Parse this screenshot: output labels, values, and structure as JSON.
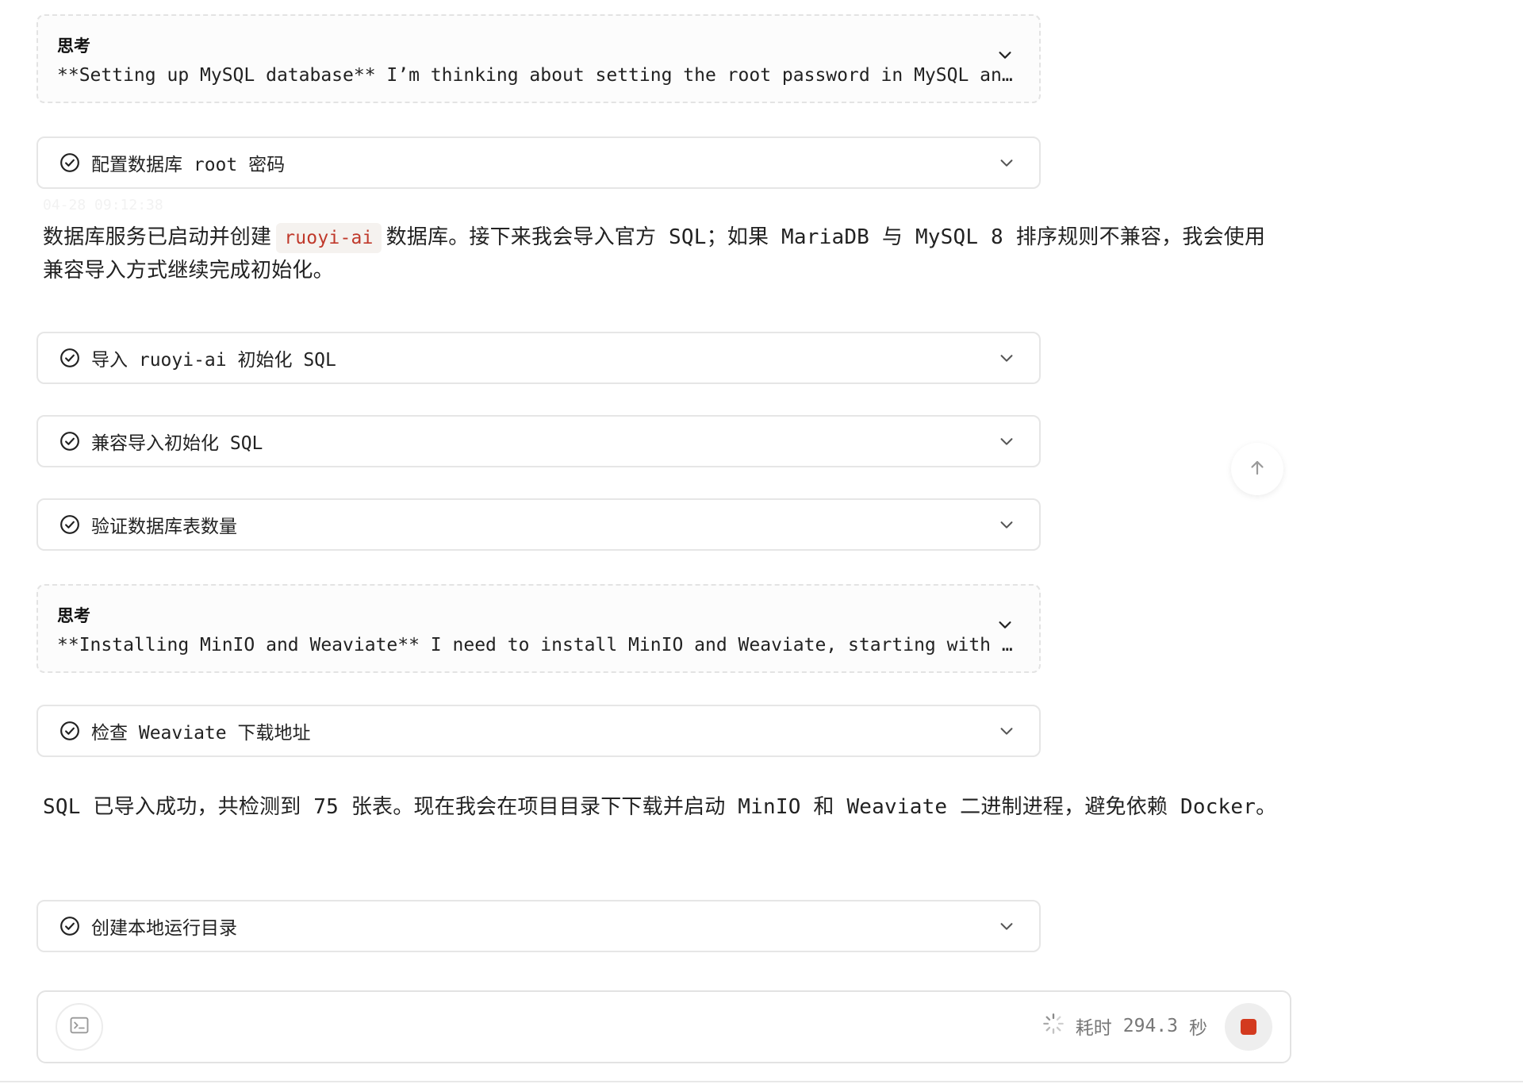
{
  "thinking_1": {
    "title": "思考",
    "text": "**Setting up MySQL database** I’m thinking about setting the root password in MySQL and checking whether the database service is running before creating the project database."
  },
  "steps": {
    "configure_root_password": "配置数据库 root 密码",
    "import_sql": "导入 ruoyi-ai 初始化 SQL",
    "compat_import_sql": "兼容导入初始化 SQL",
    "verify_table_count": "验证数据库表数量",
    "check_weaviate_url": "检查 Weaviate 下载地址",
    "create_local_dir": "创建本地运行目录"
  },
  "message_1": {
    "timestamp": "04-28 09:12:38",
    "before": "数据库服务已启动并创建",
    "code": "ruoyi-ai",
    "after": "数据库。接下来我会导入官方 SQL；如果 MariaDB 与 MySQL 8 排序规则不兼容，我会使用兼容导入方式继续完成初始化。"
  },
  "thinking_2": {
    "title": "思考",
    "text": "**Installing MinIO and Weaviate** I need to install MinIO and Weaviate, starting with checking the download addresses for the binaries in the project directory."
  },
  "message_2": {
    "text": "SQL 已导入成功，共检测到 75 张表。现在我会在项目目录下下载并启动 MinIO 和 Weaviate 二进制进程，避免依赖 Docker。"
  },
  "composer": {
    "elapsed_label": "耗时",
    "elapsed_value": "294.3",
    "elapsed_unit": "秒"
  },
  "colors": {
    "accent_stop": "#d33a1f",
    "code_text": "#c0392b",
    "code_bg": "#f5f2ef"
  },
  "icons": [
    "check-circle-icon",
    "chevron-down-icon",
    "arrow-up-icon",
    "terminal-icon",
    "spinner-icon",
    "stop-icon"
  ]
}
